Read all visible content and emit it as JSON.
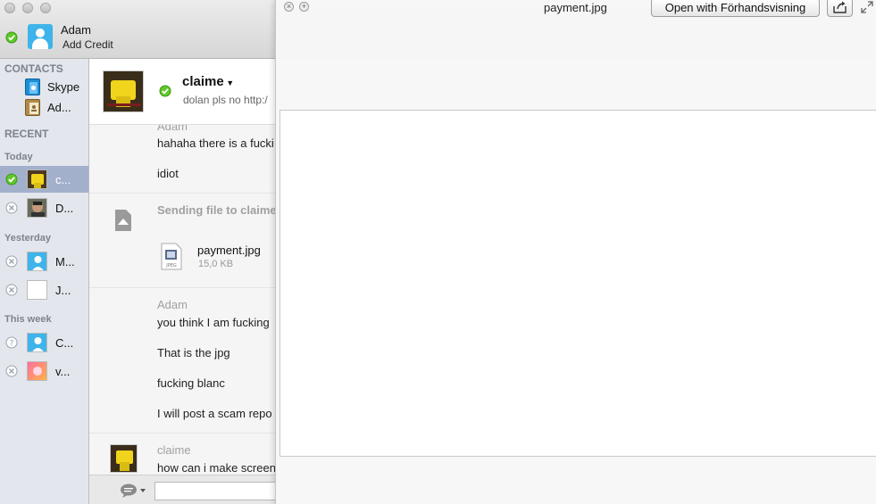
{
  "profile": {
    "name": "Adam",
    "credit": "Add Credit"
  },
  "sidebar": {
    "contacts_heading": "CONTACTS",
    "contacts": [
      {
        "label": "Skype",
        "icon": "skype-directory-icon"
      },
      {
        "label": "Ad...",
        "icon": "address-book-icon"
      }
    ],
    "recent_heading": "RECENT",
    "today_heading": "Today",
    "yesterday_heading": "Yesterday",
    "thisweek_heading": "This week",
    "recent": [
      {
        "label": "c...",
        "status": "online",
        "selected": true
      },
      {
        "label": "D...",
        "status": "offline"
      },
      {
        "label": "M...",
        "status": "offline"
      },
      {
        "label": "J...",
        "status": "offline"
      },
      {
        "label": "C...",
        "status": "unknown"
      },
      {
        "label": "v...",
        "status": "offline"
      }
    ]
  },
  "chat": {
    "name": "claime",
    "mood": "dolan pls no   http:/",
    "messages": {
      "g1_sender": "Adam",
      "g1_line1": "hahaha there is a fucki",
      "g1_line2": "idiot",
      "file_status": "Sending file to claime",
      "file_name": "payment.jpg",
      "file_size": "15,0 KB",
      "g3_sender": "Adam",
      "g3_line1": "you think I am fucking",
      "g3_line2": "That is the jpg",
      "g3_line3": "fucking blanc",
      "g3_line4": "I will post a scam repo",
      "g4_sender": "claime",
      "g4_line1": "how can i make screen"
    },
    "input_placeholder": ""
  },
  "quicklook": {
    "title": "payment.jpg",
    "open_with": "Open with Förhandsvisning"
  },
  "colors": {
    "selected_row": "#a2b0cc",
    "online_green": "#5fc72a",
    "skype_blue": "#3eb4ea"
  }
}
